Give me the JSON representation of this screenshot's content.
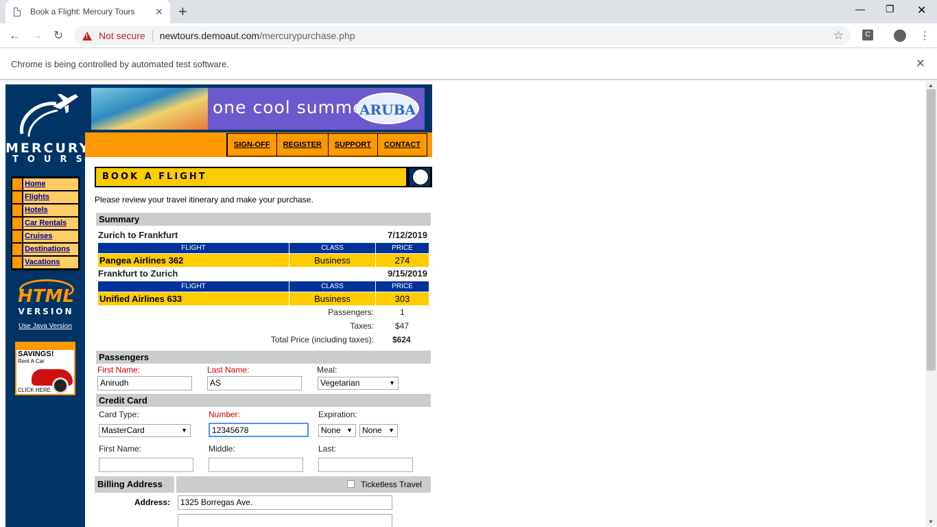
{
  "browser": {
    "tab_title": "Book a Flight: Mercury Tours",
    "security_label": "Not secure",
    "url_host": "newtours.demoaut.com",
    "url_path": "/mercurypurchase.php",
    "automation_notice": "Chrome is being controlled by automated test software."
  },
  "site": {
    "logo_line1": "MERCURY",
    "logo_line2": "TOURS",
    "side_nav": [
      "Home",
      "Flights",
      "Hotels",
      "Car Rentals",
      "Cruises",
      "Destinations",
      "Vacations"
    ],
    "html_logo": "HTML",
    "html_logo_sub": "VERSION",
    "java_link": "Use Java Version",
    "ad_title": "SAVINGS!",
    "ad_sub": "Rent A Car",
    "ad_cta": "CLICK HERE",
    "banner_slogan": "one cool summer",
    "banner_brand": "ARUBA",
    "top_nav": [
      "SIGN-OFF",
      "REGISTER",
      "SUPPORT",
      "CONTACT"
    ]
  },
  "page": {
    "heading": "BOOK A FLIGHT",
    "intro": "Please review your travel itinerary and make your purchase."
  },
  "summary": {
    "title": "Summary",
    "col_flight": "FLIGHT",
    "col_class": "CLASS",
    "col_price": "PRICE",
    "depart": {
      "route": "Zurich to Frankfurt",
      "date": "7/12/2019",
      "flight": "Pangea Airlines 362",
      "class": "Business",
      "price": "274"
    },
    "return": {
      "route": "Frankfurt to Zurich",
      "date": "9/15/2019",
      "flight": "Unified Airlines 633",
      "class": "Business",
      "price": "303"
    },
    "passengers_label": "Passengers:",
    "passengers": "1",
    "taxes_label": "Taxes:",
    "taxes": "$47",
    "total_label": "Total Price (including taxes):",
    "total": "$624"
  },
  "passengers": {
    "title": "Passengers",
    "first_label": "First Name:",
    "first_value": "Anirudh",
    "last_label": "Last Name:",
    "last_value": "AS",
    "meal_label": "Meal:",
    "meal_value": "Vegetarian"
  },
  "card": {
    "title": "Credit Card",
    "type_label": "Card Type:",
    "type_value": "MasterCard",
    "number_label": "Number:",
    "number_value": "12345678",
    "exp_label": "Expiration:",
    "exp_month": "None",
    "exp_year": "None",
    "first_label": "First Name:",
    "middle_label": "Middle:",
    "last_label": "Last:"
  },
  "billing": {
    "title": "Billing Address",
    "ticketless_label": "Ticketless Travel",
    "address_label": "Address:",
    "address_value": "1325 Borregas Ave."
  }
}
